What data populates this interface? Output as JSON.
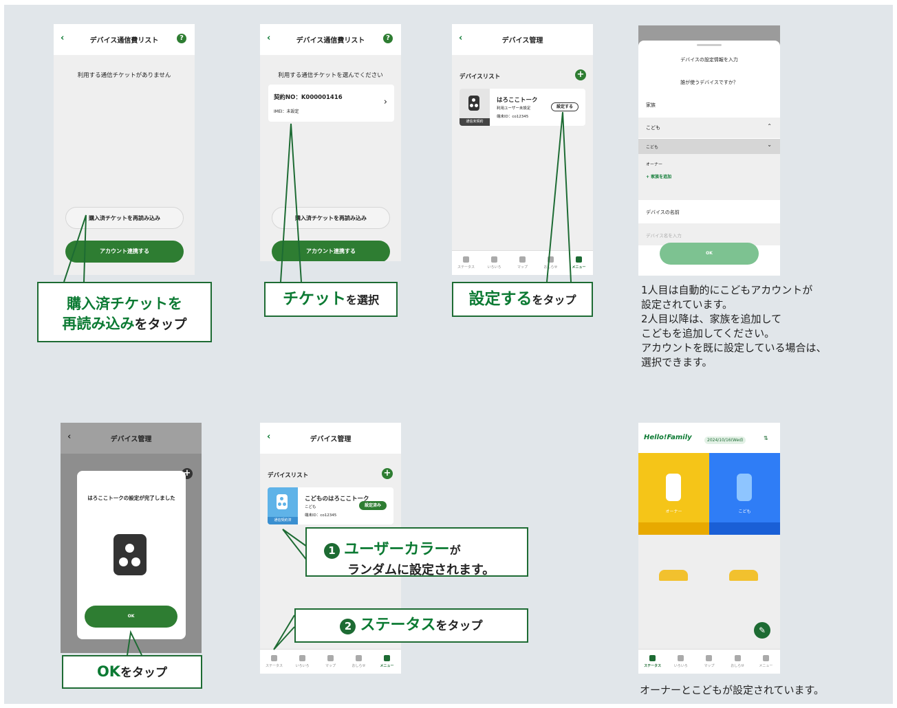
{
  "screen1": {
    "title": "デバイス通信費リスト",
    "empty_message": "利用する通信チケットがありません",
    "reload_button": "購入済チケットを再読み込み",
    "link_button": "アカウント連携する"
  },
  "callout1": {
    "line1": "購入済チケットを",
    "line2_green": "再読み込み",
    "line2_rest": "をタップ"
  },
  "screen2": {
    "title": "デバイス通信費リスト",
    "instruction": "利用する通信チケットを選んでください",
    "ticket_no": "契約NO：K000001416",
    "imei": "IMEI：未設定",
    "reload_button": "購入済チケットを再読み込み",
    "link_button": "アカウント連携する"
  },
  "callout2": {
    "green": "チケット",
    "rest": "を選択"
  },
  "screen3": {
    "title": "デバイス管理",
    "list_label": "デバイスリスト",
    "device_name": "はろここトーク",
    "user": "利用ユーザー未設定",
    "terminal_id": "端末ID：co12345",
    "status": "通信未契約",
    "setup_button": "設定する",
    "nav": [
      "ステータス",
      "いろいろ",
      "マップ",
      "おしらせ",
      "メニュー"
    ]
  },
  "callout3": {
    "green": "設定する",
    "rest": "をタップ"
  },
  "screen4": {
    "sheet_title": "デバイスの設定情報を入力",
    "question": "誰が使うデバイスですか？",
    "family_label": "家族",
    "selected": "こども",
    "option_child": "こども",
    "option_owner": "オーナー",
    "add_family": "+ 家族を追加",
    "name_label": "デバイスの名前",
    "name_placeholder": "デバイス名を入力",
    "ok_button": "OK"
  },
  "note1": [
    "1人目は自動的にこどもアカウントが",
    "設定されています。",
    "2人目以降は、家族を追加して",
    "こどもを追加してください。",
    "アカウントを既に設定している場合は、",
    "選択できます。"
  ],
  "screen5": {
    "title": "デバイス管理",
    "dialog_message": "はろここトークの設定が完了しました",
    "ok_button": "OK"
  },
  "callout5": {
    "green": "OK",
    "rest": "をタップ"
  },
  "screen6": {
    "title": "デバイス管理",
    "list_label": "デバイスリスト",
    "device_name": "こどものはろここトーク",
    "user": "こども",
    "terminal_id": "端末ID：co12345",
    "status": "通信契約済",
    "setup_button": "設定済み",
    "nav": [
      "ステータス",
      "いろいろ",
      "マップ",
      "おしらせ",
      "メニュー"
    ]
  },
  "callout6a": {
    "num": "1",
    "green": "ユーザーカラー",
    "rest1": "が",
    "line2": "ランダムに設定されます。"
  },
  "callout6b": {
    "num": "2",
    "green": "ステータス",
    "rest": "をタップ"
  },
  "screen7": {
    "logo_a": "Hello!",
    "logo_b": "Family",
    "date": "2024/10/16(Wed)",
    "owner_label": "オーナー",
    "child_label": "こども",
    "nav": [
      "ステータス",
      "いろいろ",
      "マップ",
      "おしらせ",
      "メニュー"
    ]
  },
  "note2": "オーナーとこどもが設定されています。",
  "colors": {
    "green": "#2e7d32",
    "owner": "#f5c518",
    "child": "#2f7df6"
  }
}
